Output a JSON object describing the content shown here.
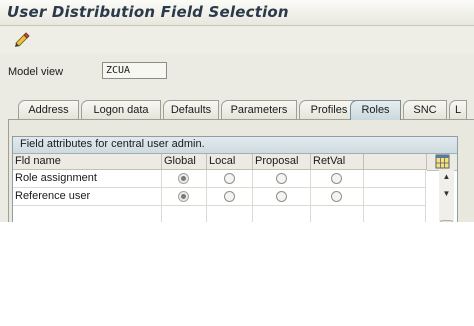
{
  "window": {
    "title": "User Distribution Field Selection"
  },
  "toolbar": {
    "buttons": [
      {
        "icon": "edit-pencil-icon"
      }
    ]
  },
  "model_view": {
    "label": "Model view",
    "value": "ZCUA"
  },
  "tabs": [
    {
      "label": "Address",
      "active": false
    },
    {
      "label": "Logon data",
      "active": false
    },
    {
      "label": "Defaults",
      "active": false
    },
    {
      "label": "Parameters",
      "active": false
    },
    {
      "label": "Profiles",
      "active": false
    },
    {
      "label": "Roles",
      "active": true
    },
    {
      "label": "SNC",
      "active": false
    },
    {
      "label": "L",
      "active": false
    }
  ],
  "group": {
    "title": "Field attributes for central user admin."
  },
  "table": {
    "columns": [
      "Fld name",
      "Global",
      "Local",
      "Proposal",
      "RetVal"
    ],
    "rows": [
      {
        "name": "Role assignment",
        "selected": "Global"
      },
      {
        "name": "Reference user",
        "selected": "Global"
      }
    ],
    "settings_icon": "table-settings-icon"
  },
  "colors": {
    "active_tab": "#c9d8de",
    "title_text": "#2b3a4a",
    "background": "#ecebe3"
  }
}
